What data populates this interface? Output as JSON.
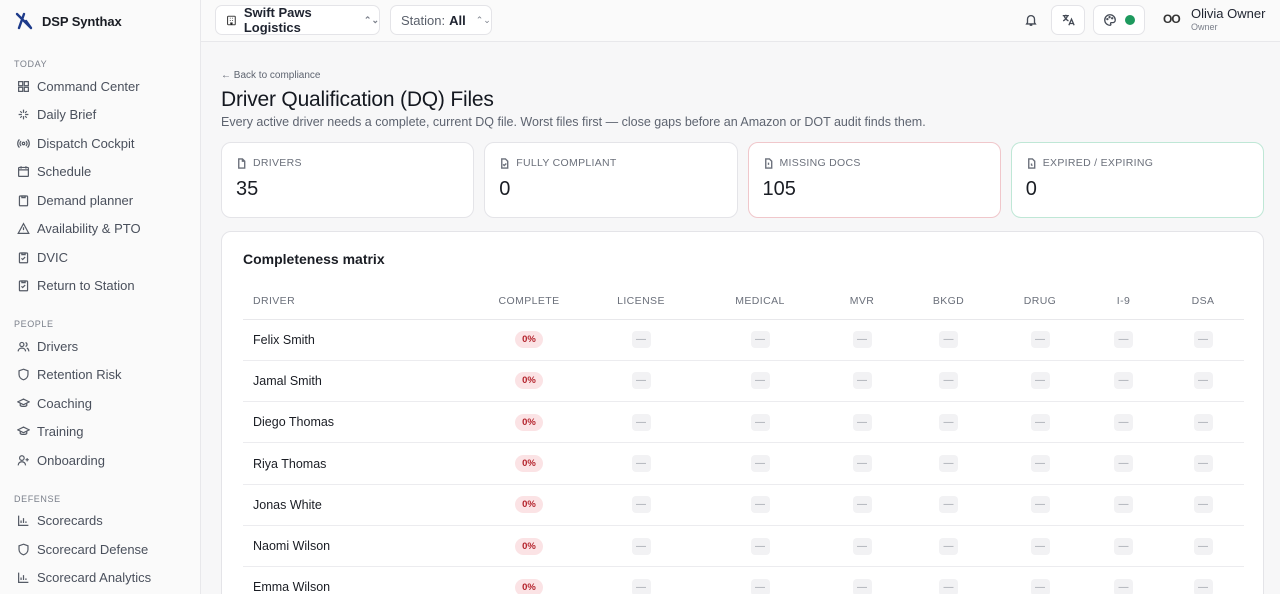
{
  "app": {
    "name": "DSP Synthax"
  },
  "topbar": {
    "org_name": "Swift Paws Logistics",
    "station_label": "Station:",
    "station_value": "All",
    "user_initials": "OO",
    "user_name": "Olivia Owner",
    "user_role": "Owner",
    "status_color": "#1e9a5e"
  },
  "sidebar": {
    "sections": [
      {
        "label": "TODAY",
        "items": [
          {
            "label": "Command Center",
            "icon": "grid-icon"
          },
          {
            "label": "Daily Brief",
            "icon": "sparkle-icon"
          },
          {
            "label": "Dispatch Cockpit",
            "icon": "radio-icon"
          },
          {
            "label": "Schedule",
            "icon": "calendar-icon"
          },
          {
            "label": "Demand planner",
            "icon": "clipboard-icon"
          },
          {
            "label": "Availability & PTO",
            "icon": "warning-icon"
          },
          {
            "label": "DVIC",
            "icon": "checklist-icon"
          },
          {
            "label": "Return to Station",
            "icon": "clipboard-check-icon"
          }
        ]
      },
      {
        "label": "PEOPLE",
        "items": [
          {
            "label": "Drivers",
            "icon": "users-icon"
          },
          {
            "label": "Retention Risk",
            "icon": "shield-icon"
          },
          {
            "label": "Coaching",
            "icon": "graduation-cap-icon"
          },
          {
            "label": "Training",
            "icon": "graduation-cap-icon"
          },
          {
            "label": "Onboarding",
            "icon": "user-plus-icon"
          }
        ]
      },
      {
        "label": "DEFENSE",
        "items": [
          {
            "label": "Scorecards",
            "icon": "bar-chart-icon"
          },
          {
            "label": "Scorecard Defense",
            "icon": "shield-icon"
          },
          {
            "label": "Scorecard Analytics",
            "icon": "bar-chart-icon"
          }
        ]
      }
    ]
  },
  "page": {
    "back_link": "← Back to compliance",
    "title": "Driver Qualification (DQ) Files",
    "subtitle": "Every active driver needs a complete, current DQ file. Worst files first — close gaps before an Amazon or DOT audit finds them."
  },
  "stats": [
    {
      "label": "DRIVERS",
      "value": "35"
    },
    {
      "label": "FULLY COMPLIANT",
      "value": "0"
    },
    {
      "label": "MISSING DOCS",
      "value": "105"
    },
    {
      "label": "EXPIRED / EXPIRING",
      "value": "0"
    }
  ],
  "matrix": {
    "title": "Completeness matrix",
    "columns": [
      "DRIVER",
      "COMPLETE",
      "LICENSE",
      "MEDICAL",
      "MVR",
      "BKGD",
      "DRUG",
      "I-9",
      "DSA"
    ],
    "empty_cell": "—",
    "rows": [
      {
        "driver": "Felix Smith",
        "complete": "0%"
      },
      {
        "driver": "Jamal Smith",
        "complete": "0%"
      },
      {
        "driver": "Diego Thomas",
        "complete": "0%"
      },
      {
        "driver": "Riya Thomas",
        "complete": "0%"
      },
      {
        "driver": "Jonas White",
        "complete": "0%"
      },
      {
        "driver": "Naomi Wilson",
        "complete": "0%"
      },
      {
        "driver": "Emma Wilson",
        "complete": "0%"
      }
    ]
  }
}
